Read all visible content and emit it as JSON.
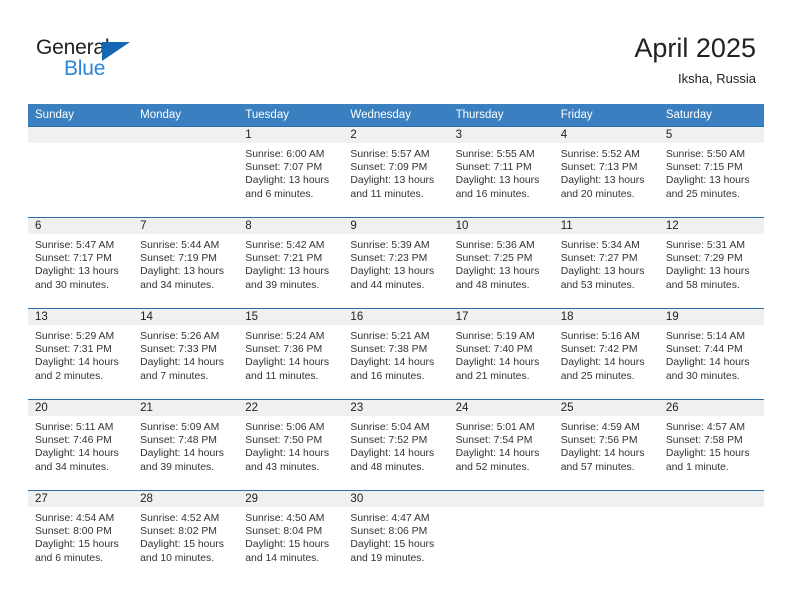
{
  "logo": {
    "word_one": "General",
    "word_two": "Blue",
    "triangle_icon": "triangle-icon",
    "brand_dark": "#231f20",
    "brand_blue": "#2a87d8",
    "triangle_blue": "#1567b5"
  },
  "header": {
    "title": "April 2025",
    "subtitle": "Iksha, Russia"
  },
  "theme": {
    "header_band": "#3a7fc0",
    "row_rule": "#2e6da4",
    "day_band": "#f0f0f0",
    "text": "#222222"
  },
  "weekdays": [
    "Sunday",
    "Monday",
    "Tuesday",
    "Wednesday",
    "Thursday",
    "Friday",
    "Saturday"
  ],
  "weeks": [
    [
      {
        "day": "",
        "sunrise": "",
        "sunset": "",
        "daylight_1": "",
        "daylight_2": ""
      },
      {
        "day": "",
        "sunrise": "",
        "sunset": "",
        "daylight_1": "",
        "daylight_2": ""
      },
      {
        "day": "1",
        "sunrise": "Sunrise: 6:00 AM",
        "sunset": "Sunset: 7:07 PM",
        "daylight_1": "Daylight: 13 hours",
        "daylight_2": "and 6 minutes."
      },
      {
        "day": "2",
        "sunrise": "Sunrise: 5:57 AM",
        "sunset": "Sunset: 7:09 PM",
        "daylight_1": "Daylight: 13 hours",
        "daylight_2": "and 11 minutes."
      },
      {
        "day": "3",
        "sunrise": "Sunrise: 5:55 AM",
        "sunset": "Sunset: 7:11 PM",
        "daylight_1": "Daylight: 13 hours",
        "daylight_2": "and 16 minutes."
      },
      {
        "day": "4",
        "sunrise": "Sunrise: 5:52 AM",
        "sunset": "Sunset: 7:13 PM",
        "daylight_1": "Daylight: 13 hours",
        "daylight_2": "and 20 minutes."
      },
      {
        "day": "5",
        "sunrise": "Sunrise: 5:50 AM",
        "sunset": "Sunset: 7:15 PM",
        "daylight_1": "Daylight: 13 hours",
        "daylight_2": "and 25 minutes."
      }
    ],
    [
      {
        "day": "6",
        "sunrise": "Sunrise: 5:47 AM",
        "sunset": "Sunset: 7:17 PM",
        "daylight_1": "Daylight: 13 hours",
        "daylight_2": "and 30 minutes."
      },
      {
        "day": "7",
        "sunrise": "Sunrise: 5:44 AM",
        "sunset": "Sunset: 7:19 PM",
        "daylight_1": "Daylight: 13 hours",
        "daylight_2": "and 34 minutes."
      },
      {
        "day": "8",
        "sunrise": "Sunrise: 5:42 AM",
        "sunset": "Sunset: 7:21 PM",
        "daylight_1": "Daylight: 13 hours",
        "daylight_2": "and 39 minutes."
      },
      {
        "day": "9",
        "sunrise": "Sunrise: 5:39 AM",
        "sunset": "Sunset: 7:23 PM",
        "daylight_1": "Daylight: 13 hours",
        "daylight_2": "and 44 minutes."
      },
      {
        "day": "10",
        "sunrise": "Sunrise: 5:36 AM",
        "sunset": "Sunset: 7:25 PM",
        "daylight_1": "Daylight: 13 hours",
        "daylight_2": "and 48 minutes."
      },
      {
        "day": "11",
        "sunrise": "Sunrise: 5:34 AM",
        "sunset": "Sunset: 7:27 PM",
        "daylight_1": "Daylight: 13 hours",
        "daylight_2": "and 53 minutes."
      },
      {
        "day": "12",
        "sunrise": "Sunrise: 5:31 AM",
        "sunset": "Sunset: 7:29 PM",
        "daylight_1": "Daylight: 13 hours",
        "daylight_2": "and 58 minutes."
      }
    ],
    [
      {
        "day": "13",
        "sunrise": "Sunrise: 5:29 AM",
        "sunset": "Sunset: 7:31 PM",
        "daylight_1": "Daylight: 14 hours",
        "daylight_2": "and 2 minutes."
      },
      {
        "day": "14",
        "sunrise": "Sunrise: 5:26 AM",
        "sunset": "Sunset: 7:33 PM",
        "daylight_1": "Daylight: 14 hours",
        "daylight_2": "and 7 minutes."
      },
      {
        "day": "15",
        "sunrise": "Sunrise: 5:24 AM",
        "sunset": "Sunset: 7:36 PM",
        "daylight_1": "Daylight: 14 hours",
        "daylight_2": "and 11 minutes."
      },
      {
        "day": "16",
        "sunrise": "Sunrise: 5:21 AM",
        "sunset": "Sunset: 7:38 PM",
        "daylight_1": "Daylight: 14 hours",
        "daylight_2": "and 16 minutes."
      },
      {
        "day": "17",
        "sunrise": "Sunrise: 5:19 AM",
        "sunset": "Sunset: 7:40 PM",
        "daylight_1": "Daylight: 14 hours",
        "daylight_2": "and 21 minutes."
      },
      {
        "day": "18",
        "sunrise": "Sunrise: 5:16 AM",
        "sunset": "Sunset: 7:42 PM",
        "daylight_1": "Daylight: 14 hours",
        "daylight_2": "and 25 minutes."
      },
      {
        "day": "19",
        "sunrise": "Sunrise: 5:14 AM",
        "sunset": "Sunset: 7:44 PM",
        "daylight_1": "Daylight: 14 hours",
        "daylight_2": "and 30 minutes."
      }
    ],
    [
      {
        "day": "20",
        "sunrise": "Sunrise: 5:11 AM",
        "sunset": "Sunset: 7:46 PM",
        "daylight_1": "Daylight: 14 hours",
        "daylight_2": "and 34 minutes."
      },
      {
        "day": "21",
        "sunrise": "Sunrise: 5:09 AM",
        "sunset": "Sunset: 7:48 PM",
        "daylight_1": "Daylight: 14 hours",
        "daylight_2": "and 39 minutes."
      },
      {
        "day": "22",
        "sunrise": "Sunrise: 5:06 AM",
        "sunset": "Sunset: 7:50 PM",
        "daylight_1": "Daylight: 14 hours",
        "daylight_2": "and 43 minutes."
      },
      {
        "day": "23",
        "sunrise": "Sunrise: 5:04 AM",
        "sunset": "Sunset: 7:52 PM",
        "daylight_1": "Daylight: 14 hours",
        "daylight_2": "and 48 minutes."
      },
      {
        "day": "24",
        "sunrise": "Sunrise: 5:01 AM",
        "sunset": "Sunset: 7:54 PM",
        "daylight_1": "Daylight: 14 hours",
        "daylight_2": "and 52 minutes."
      },
      {
        "day": "25",
        "sunrise": "Sunrise: 4:59 AM",
        "sunset": "Sunset: 7:56 PM",
        "daylight_1": "Daylight: 14 hours",
        "daylight_2": "and 57 minutes."
      },
      {
        "day": "26",
        "sunrise": "Sunrise: 4:57 AM",
        "sunset": "Sunset: 7:58 PM",
        "daylight_1": "Daylight: 15 hours",
        "daylight_2": "and 1 minute."
      }
    ],
    [
      {
        "day": "27",
        "sunrise": "Sunrise: 4:54 AM",
        "sunset": "Sunset: 8:00 PM",
        "daylight_1": "Daylight: 15 hours",
        "daylight_2": "and 6 minutes."
      },
      {
        "day": "28",
        "sunrise": "Sunrise: 4:52 AM",
        "sunset": "Sunset: 8:02 PM",
        "daylight_1": "Daylight: 15 hours",
        "daylight_2": "and 10 minutes."
      },
      {
        "day": "29",
        "sunrise": "Sunrise: 4:50 AM",
        "sunset": "Sunset: 8:04 PM",
        "daylight_1": "Daylight: 15 hours",
        "daylight_2": "and 14 minutes."
      },
      {
        "day": "30",
        "sunrise": "Sunrise: 4:47 AM",
        "sunset": "Sunset: 8:06 PM",
        "daylight_1": "Daylight: 15 hours",
        "daylight_2": "and 19 minutes."
      },
      {
        "day": "",
        "sunrise": "",
        "sunset": "",
        "daylight_1": "",
        "daylight_2": ""
      },
      {
        "day": "",
        "sunrise": "",
        "sunset": "",
        "daylight_1": "",
        "daylight_2": ""
      },
      {
        "day": "",
        "sunrise": "",
        "sunset": "",
        "daylight_1": "",
        "daylight_2": ""
      }
    ]
  ]
}
